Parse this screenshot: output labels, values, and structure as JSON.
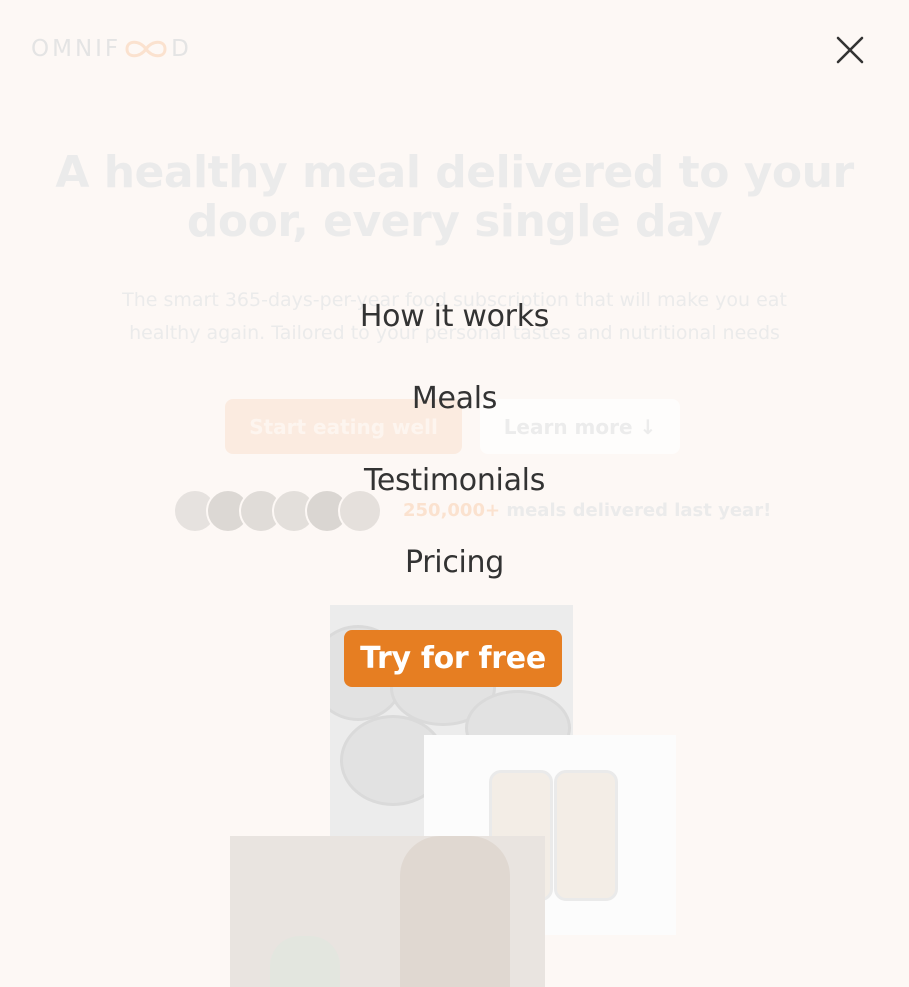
{
  "logo": {
    "text_left": "OMNIF",
    "text_right": "D",
    "icon": "infinity-icon"
  },
  "hero": {
    "title": "A healthy meal delivered to your door, every single day",
    "subtitle": "The smart 365-days-per-year food subscription that will make you eat healthy again. Tailored to your personal tastes and nutritional needs",
    "primary_button": "Start eating well",
    "secondary_button": "Learn more ↓",
    "delivered_count": "250,000+",
    "delivered_text": " meals delivered last year!"
  },
  "nav": {
    "items": [
      {
        "label": "How it works"
      },
      {
        "label": "Meals"
      },
      {
        "label": "Testimonials"
      },
      {
        "label": "Pricing"
      }
    ],
    "cta": "Try for free",
    "close_icon": "close-icon"
  },
  "colors": {
    "accent": "#e67e22",
    "text": "#333333",
    "background": "#fdf8f5"
  }
}
